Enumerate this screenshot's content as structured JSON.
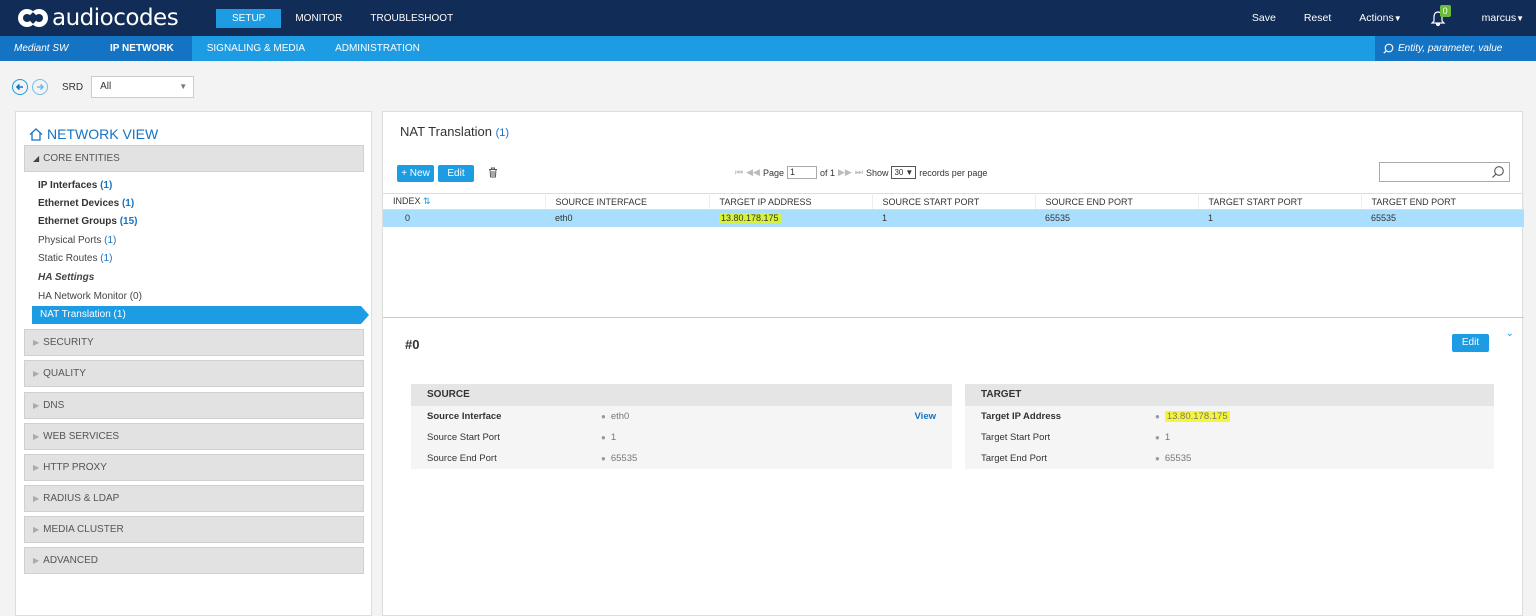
{
  "brand": {
    "logo_text": "audiocodes"
  },
  "topnav": {
    "items": [
      "SETUP",
      "MONITOR",
      "TROUBLESHOOT"
    ]
  },
  "topright": {
    "save": "Save",
    "reset": "Reset",
    "actions": "Actions",
    "notifications": "0",
    "user": "marcus"
  },
  "subbar": {
    "product": "Mediant SW",
    "items": [
      "IP NETWORK",
      "SIGNALING & MEDIA",
      "ADMINISTRATION"
    ],
    "search_placeholder": "Entity, parameter, value"
  },
  "srd": {
    "label": "SRD",
    "value": "All"
  },
  "network_view": {
    "title": "NETWORK VIEW",
    "core_entities": "CORE ENTITIES",
    "items": [
      {
        "label": "IP Interfaces",
        "count": "(1)"
      },
      {
        "label": "Ethernet Devices",
        "count": "(1)"
      },
      {
        "label": "Ethernet Groups",
        "count": "(15)"
      },
      {
        "label": "Physical Ports",
        "count": "(1)"
      },
      {
        "label": "Static Routes",
        "count": "(1)"
      },
      {
        "label": "HA Settings",
        "count": ""
      },
      {
        "label": "HA Network Monitor (0)",
        "count": ""
      },
      {
        "label": "NAT Translation (1)",
        "count": ""
      }
    ],
    "categories": [
      "SECURITY",
      "QUALITY",
      "DNS",
      "WEB SERVICES",
      "HTTP PROXY",
      "RADIUS & LDAP",
      "MEDIA CLUSTER",
      "ADVANCED"
    ]
  },
  "panel": {
    "title": "NAT Translation",
    "count": "(1)",
    "new_label": "+ New",
    "edit_label": "Edit",
    "pager": {
      "page_label": "Page",
      "page_value": "1",
      "of_label": "of 1",
      "show_label": "Show",
      "per_page": "30",
      "records_label": "records per page"
    }
  },
  "table": {
    "columns": [
      "INDEX",
      "SOURCE INTERFACE",
      "TARGET IP ADDRESS",
      "SOURCE START PORT",
      "SOURCE END PORT",
      "TARGET START PORT",
      "TARGET END PORT"
    ],
    "rows": [
      [
        "0",
        "eth0",
        "13.80.178.175",
        "1",
        "65535",
        "1",
        "65535"
      ]
    ]
  },
  "detail": {
    "title": "#0",
    "edit_label": "Edit",
    "source": {
      "heading": "SOURCE",
      "rows": [
        {
          "label": "Source Interface",
          "value": "eth0",
          "link": "View"
        },
        {
          "label": "Source Start Port",
          "value": "1"
        },
        {
          "label": "Source End Port",
          "value": "65535"
        }
      ]
    },
    "target": {
      "heading": "TARGET",
      "rows": [
        {
          "label": "Target IP Address",
          "value": "13.80.178.175"
        },
        {
          "label": "Target Start Port",
          "value": "1"
        },
        {
          "label": "Target End Port",
          "value": "65535"
        }
      ]
    }
  },
  "colors": {
    "navy": "#112c57",
    "accent": "#1d9be3",
    "accent_dark": "#1573c4",
    "row_selected": "#a9defc",
    "highlight": "#d6f23a"
  }
}
